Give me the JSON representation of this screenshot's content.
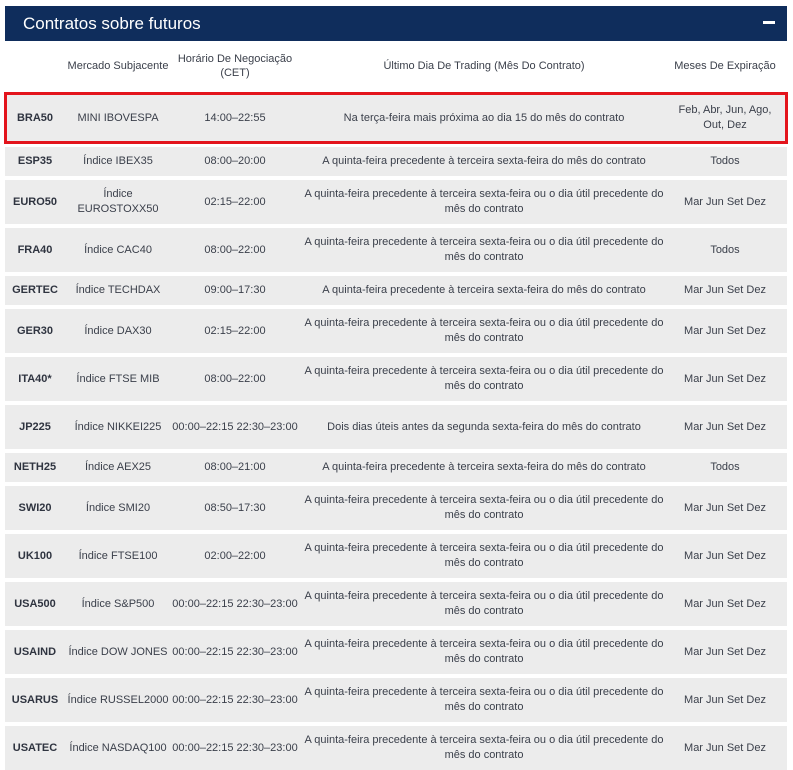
{
  "panel": {
    "title": "Contratos sobre futuros",
    "collapse_symbol": "−"
  },
  "columns": [
    "",
    "Mercado Subjacente",
    "Horário De Negociação (CET)",
    "Último Dia De Trading (Mês Do Contrato)",
    "Meses De Expiração"
  ],
  "rows": [
    {
      "symbol": "BRA50",
      "market": "MINI IBOVESPA",
      "hours": "14:00–22:55",
      "last_day": "Na terça-feira mais próxima ao dia 15 do mês do contrato",
      "months": "Feb, Abr, Jun, Ago, Out, Dez",
      "highlighted": true
    },
    {
      "symbol": "ESP35",
      "market": "Índice IBEX35",
      "hours": "08:00–20:00",
      "last_day": "A quinta-feira precedente à terceira sexta-feira do mês do contrato",
      "months": "Todos"
    },
    {
      "symbol": "EURO50",
      "market": "Índice EUROSTOXX50",
      "hours": "02:15–22:00",
      "last_day": "A quinta-feira precedente à terceira sexta-feira ou o dia útil precedente do mês do contrato",
      "months": "Mar Jun Set Dez"
    },
    {
      "symbol": "FRA40",
      "market": "Índice CAC40",
      "hours": "08:00–22:00",
      "last_day": "A quinta-feira precedente à terceira sexta-feira ou o dia útil precedente do mês do contrato",
      "months": "Todos"
    },
    {
      "symbol": "GERTEC",
      "market": "Índice TECHDAX",
      "hours": "09:00–17:30",
      "last_day": "A quinta-feira precedente à terceira sexta-feira do mês do contrato",
      "months": "Mar Jun Set Dez"
    },
    {
      "symbol": "GER30",
      "market": "Índice DAX30",
      "hours": "02:15–22:00",
      "last_day": "A quinta-feira precedente à terceira sexta-feira ou o dia útil precedente do mês do contrato",
      "months": "Mar Jun Set Dez"
    },
    {
      "symbol": "ITA40*",
      "market": "Índice FTSE MIB",
      "hours": "08:00–22:00",
      "last_day": "A quinta-feira precedente à terceira sexta-feira ou o dia útil precedente do mês do contrato",
      "months": "Mar Jun Set Dez"
    },
    {
      "symbol": "JP225",
      "market": "Índice NIKKEI225",
      "hours": "00:00–22:15 22:30–23:00",
      "last_day": "Dois dias úteis antes da segunda sexta-feira do mês do contrato",
      "months": "Mar Jun Set Dez"
    },
    {
      "symbol": "NETH25",
      "market": "Índice AEX25",
      "hours": "08:00–21:00",
      "last_day": "A quinta-feira precedente à terceira sexta-feira do mês do contrato",
      "months": "Todos"
    },
    {
      "symbol": "SWI20",
      "market": "Índice SMI20",
      "hours": "08:50–17:30",
      "last_day": "A quinta-feira precedente à terceira sexta-feira ou o dia útil precedente do mês do contrato",
      "months": "Mar Jun Set Dez"
    },
    {
      "symbol": "UK100",
      "market": "Índice FTSE100",
      "hours": "02:00–22:00",
      "last_day": "A quinta-feira precedente à terceira sexta-feira ou o dia útil precedente do mês do contrato",
      "months": "Mar Jun Set Dez"
    },
    {
      "symbol": "USA500",
      "market": "Índice S&P500",
      "hours": "00:00–22:15 22:30–23:00",
      "last_day": "A quinta-feira precedente à terceira sexta-feira ou o dia útil precedente do mês do contrato",
      "months": "Mar Jun Set Dez"
    },
    {
      "symbol": "USAIND",
      "market": "Índice DOW JONES",
      "hours": "00:00–22:15 22:30–23:00",
      "last_day": "A quinta-feira precedente à terceira sexta-feira ou o dia útil precedente do mês do contrato",
      "months": "Mar Jun Set Dez"
    },
    {
      "symbol": "USARUS",
      "market": "Índice RUSSEL2000",
      "hours": "00:00–22:15 22:30–23:00",
      "last_day": "A quinta-feira precedente à terceira sexta-feira ou o dia útil precedente do mês do contrato",
      "months": "Mar Jun Set Dez"
    },
    {
      "symbol": "USATEC",
      "market": "Índice NASDAQ100",
      "hours": "00:00–22:15 22:30–23:00",
      "last_day": "A quinta-feira precedente à terceira sexta-feira ou o dia útil precedente do mês do contrato",
      "months": "Mar Jun Set Dez"
    }
  ],
  "colors": {
    "header_bg": "#0f2d5c",
    "row_bg": "#ececec",
    "highlight_border": "#e3141c"
  }
}
